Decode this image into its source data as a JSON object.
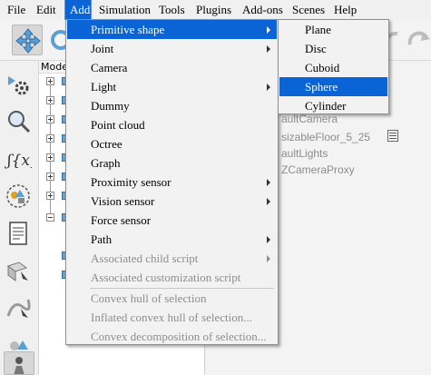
{
  "menubar": {
    "items": [
      "File",
      "Edit",
      "Add",
      "Simulation",
      "Tools",
      "Plugins",
      "Add-ons",
      "Scenes",
      "Help"
    ],
    "active": "Add"
  },
  "hierarchy": {
    "header": "Mode"
  },
  "viewport": {
    "objects": [
      "aultCamera",
      "sizableFloor_5_25",
      "aultLights",
      "ZCameraProxy"
    ]
  },
  "add_menu": {
    "items": [
      {
        "label": "Primitive shape",
        "submenu": true,
        "highlighted": true,
        "enabled": true
      },
      {
        "label": "Joint",
        "submenu": true,
        "enabled": true
      },
      {
        "label": "Camera",
        "submenu": false,
        "enabled": true
      },
      {
        "label": "Light",
        "submenu": true,
        "enabled": true
      },
      {
        "label": "Dummy",
        "submenu": false,
        "enabled": true
      },
      {
        "label": "Point cloud",
        "submenu": false,
        "enabled": true
      },
      {
        "label": "Octree",
        "submenu": false,
        "enabled": true
      },
      {
        "label": "Graph",
        "submenu": false,
        "enabled": true
      },
      {
        "label": "Proximity sensor",
        "submenu": true,
        "enabled": true
      },
      {
        "label": "Vision sensor",
        "submenu": true,
        "enabled": true
      },
      {
        "label": "Force sensor",
        "submenu": false,
        "enabled": true
      },
      {
        "label": "Path",
        "submenu": true,
        "enabled": true
      },
      {
        "label": "Associated child script",
        "submenu": true,
        "enabled": false
      },
      {
        "label": "Associated customization script",
        "submenu": false,
        "enabled": false
      },
      {
        "label": "Convex hull of selection",
        "submenu": false,
        "enabled": false
      },
      {
        "label": "Inflated convex hull of selection...",
        "submenu": false,
        "enabled": false
      },
      {
        "label": "Convex decomposition of selection...",
        "submenu": false,
        "enabled": false
      }
    ]
  },
  "primitive_menu": {
    "items": [
      "Plane",
      "Disc",
      "Cuboid",
      "Sphere",
      "Cylinder"
    ],
    "highlighted": "Sphere"
  },
  "colors": {
    "highlight": "#0a64d6",
    "menu_bg": "#f2f2f2",
    "disabled_text": "#8d8d8d"
  },
  "icons": {
    "toolbar": [
      "move-icon",
      "rotate-icon",
      "undo-icon",
      "redo-icon"
    ],
    "left_toolbar": [
      "simulation-settings-icon",
      "magnifier-icon",
      "calculation-modules-icon",
      "collection-icon",
      "script-icon",
      "shape-edit-icon",
      "path-edit-icon",
      "selection-icon",
      "model-browser-icon"
    ]
  }
}
